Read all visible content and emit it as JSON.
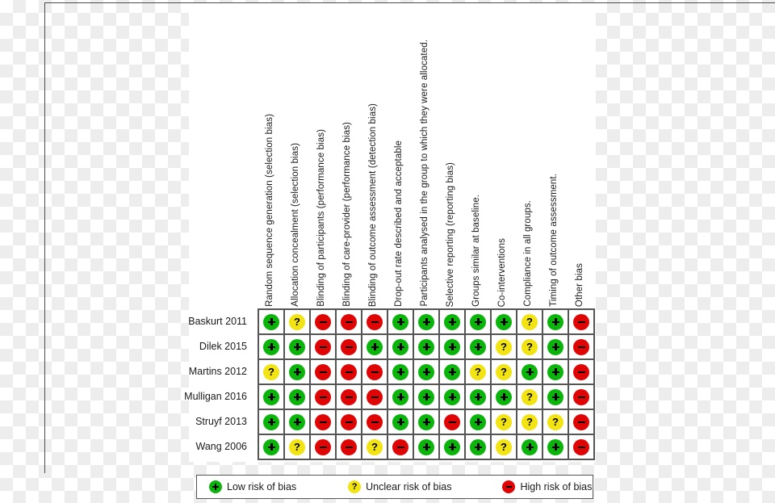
{
  "figure": {
    "type": "risk-of-bias-summary",
    "caption": "",
    "colors": {
      "low": "#0ab40a",
      "unclear": "#f2e312",
      "high": "#e00505",
      "grid_line": "#555555",
      "text": "#1a1a1a"
    }
  },
  "domains": [
    "Random sequence generation (selection bias)",
    "Allocation concealment (selection bias)",
    "Blinding of participants (performance bias)",
    "Blinding of care-provider (performance bias)",
    "Blinding of outcome assessment (detection bias)",
    "Drop-out rate described and acceptable",
    "Participants analysed in the group to which they were allocated.",
    "Selective reporting (reporting bias)",
    "Groups similar at baseline.",
    "Co-interventions",
    "Compliance in all groups.",
    "Timing of outcome assessment.",
    "Other bias"
  ],
  "studies": [
    "Baskurt 2011",
    "Dilek 2015",
    "Martins 2012",
    "Mulligan 2016",
    "Struyf 2013",
    "Wang 2006"
  ],
  "judgements": [
    [
      "low",
      "unclear",
      "high",
      "high",
      "high",
      "low",
      "low",
      "low",
      "low",
      "low",
      "unclear",
      "low",
      "high"
    ],
    [
      "low",
      "low",
      "high",
      "high",
      "low",
      "low",
      "low",
      "low",
      "low",
      "unclear",
      "unclear",
      "low",
      "high"
    ],
    [
      "unclear",
      "low",
      "high",
      "high",
      "high",
      "low",
      "low",
      "low",
      "unclear",
      "unclear",
      "low",
      "low",
      "high"
    ],
    [
      "low",
      "low",
      "high",
      "high",
      "high",
      "low",
      "low",
      "low",
      "low",
      "low",
      "unclear",
      "low",
      "high"
    ],
    [
      "low",
      "low",
      "high",
      "high",
      "high",
      "low",
      "low",
      "high",
      "low",
      "unclear",
      "unclear",
      "unclear",
      "high"
    ],
    [
      "low",
      "unclear",
      "high",
      "high",
      "unclear",
      "high",
      "low",
      "low",
      "low",
      "unclear",
      "low",
      "low",
      "high"
    ]
  ],
  "symbol_glyphs": {
    "low": "+",
    "unclear": "?",
    "high": "–"
  },
  "legend": [
    {
      "key": "low",
      "label": "Low risk of bias"
    },
    {
      "key": "unclear",
      "label": "Unclear risk of bias"
    },
    {
      "key": "high",
      "label": "High risk of bias"
    }
  ]
}
